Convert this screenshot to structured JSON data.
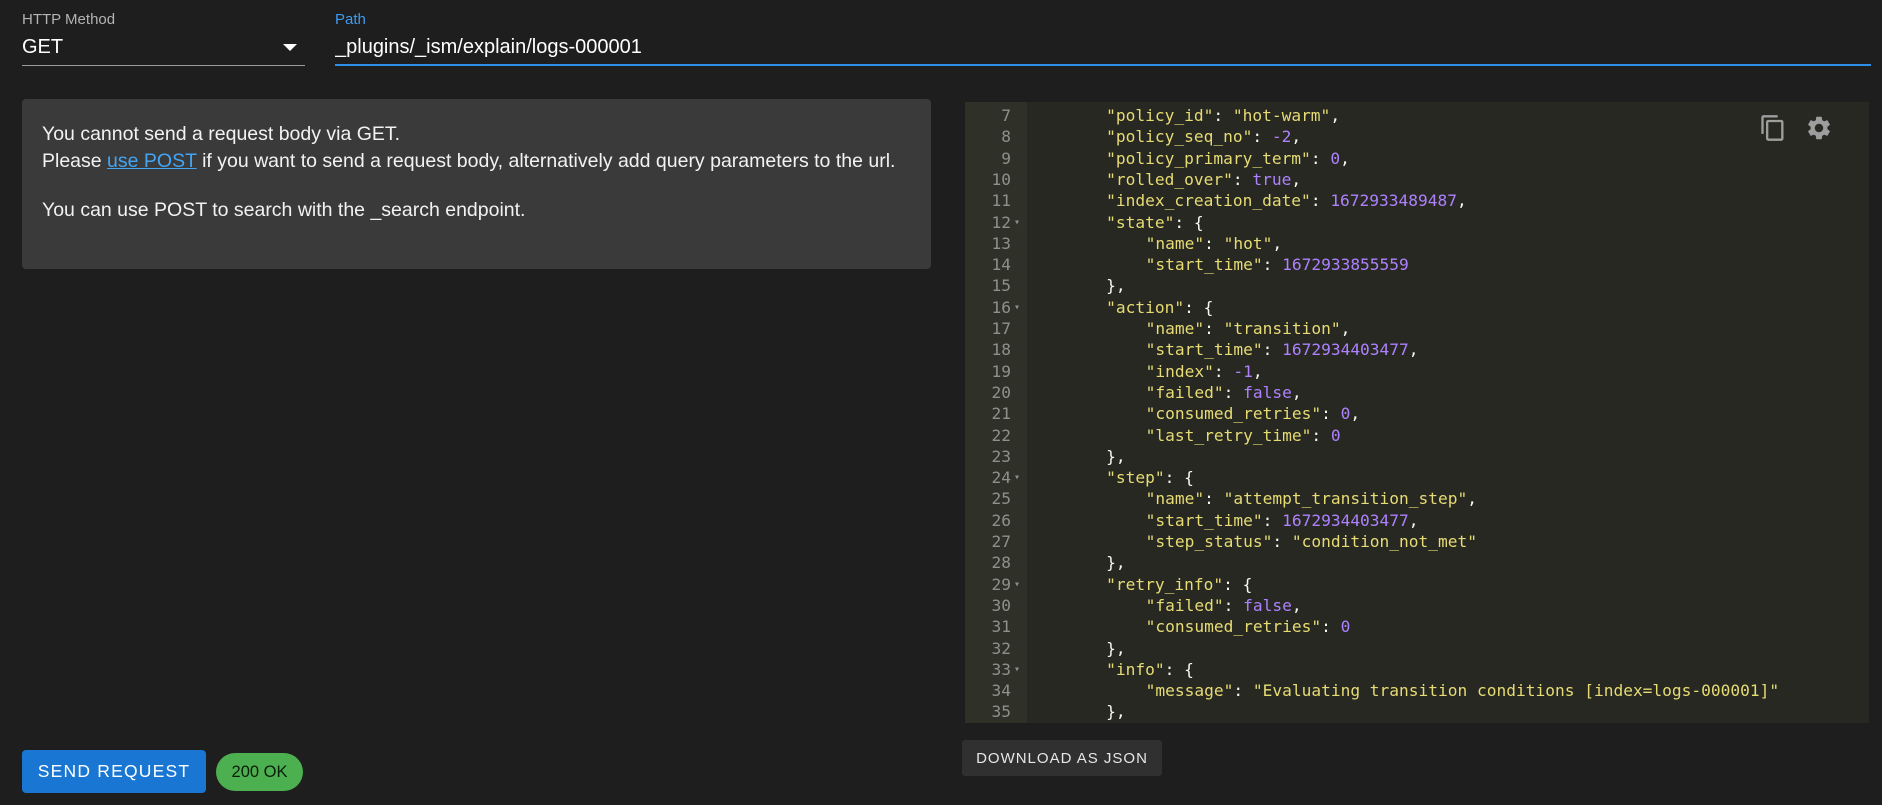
{
  "form": {
    "method_label": "HTTP Method",
    "method_value": "GET",
    "path_label": "Path",
    "path_value": "_plugins/_ism/explain/logs-000001"
  },
  "info": {
    "line1": "You cannot send a request body via GET.",
    "line2_prefix": "Please ",
    "line2_link": "use POST",
    "line2_suffix": " if you want to send a request body, alternatively add query parameters to the url.",
    "line3": "You can use POST to search with the _search endpoint."
  },
  "editor": {
    "lines": [
      {
        "n": "7",
        "fold": false,
        "indent": 2,
        "key": "\"policy_id\"",
        "value": "\"hot-warm\"",
        "vtype": "s",
        "tail": ","
      },
      {
        "n": "8",
        "fold": false,
        "indent": 2,
        "key": "\"policy_seq_no\"",
        "value": "-2",
        "vtype": "n",
        "tail": ","
      },
      {
        "n": "9",
        "fold": false,
        "indent": 2,
        "key": "\"policy_primary_term\"",
        "value": "0",
        "vtype": "n",
        "tail": ","
      },
      {
        "n": "10",
        "fold": false,
        "indent": 2,
        "key": "\"rolled_over\"",
        "value": "true",
        "vtype": "n",
        "tail": ","
      },
      {
        "n": "11",
        "fold": false,
        "indent": 2,
        "key": "\"index_creation_date\"",
        "value": "1672933489487",
        "vtype": "n",
        "tail": ","
      },
      {
        "n": "12",
        "fold": true,
        "indent": 2,
        "key": "\"state\"",
        "value": "{",
        "vtype": "p",
        "tail": ""
      },
      {
        "n": "13",
        "fold": false,
        "indent": 3,
        "key": "\"name\"",
        "value": "\"hot\"",
        "vtype": "s",
        "tail": ","
      },
      {
        "n": "14",
        "fold": false,
        "indent": 3,
        "key": "\"start_time\"",
        "value": "1672933855559",
        "vtype": "n",
        "tail": ""
      },
      {
        "n": "15",
        "fold": false,
        "indent": 2,
        "key": "",
        "value": "},",
        "vtype": "p",
        "tail": ""
      },
      {
        "n": "16",
        "fold": true,
        "indent": 2,
        "key": "\"action\"",
        "value": "{",
        "vtype": "p",
        "tail": ""
      },
      {
        "n": "17",
        "fold": false,
        "indent": 3,
        "key": "\"name\"",
        "value": "\"transition\"",
        "vtype": "s",
        "tail": ","
      },
      {
        "n": "18",
        "fold": false,
        "indent": 3,
        "key": "\"start_time\"",
        "value": "1672934403477",
        "vtype": "n",
        "tail": ","
      },
      {
        "n": "19",
        "fold": false,
        "indent": 3,
        "key": "\"index\"",
        "value": "-1",
        "vtype": "n",
        "tail": ","
      },
      {
        "n": "20",
        "fold": false,
        "indent": 3,
        "key": "\"failed\"",
        "value": "false",
        "vtype": "n",
        "tail": ","
      },
      {
        "n": "21",
        "fold": false,
        "indent": 3,
        "key": "\"consumed_retries\"",
        "value": "0",
        "vtype": "n",
        "tail": ","
      },
      {
        "n": "22",
        "fold": false,
        "indent": 3,
        "key": "\"last_retry_time\"",
        "value": "0",
        "vtype": "n",
        "tail": ""
      },
      {
        "n": "23",
        "fold": false,
        "indent": 2,
        "key": "",
        "value": "},",
        "vtype": "p",
        "tail": ""
      },
      {
        "n": "24",
        "fold": true,
        "indent": 2,
        "key": "\"step\"",
        "value": "{",
        "vtype": "p",
        "tail": ""
      },
      {
        "n": "25",
        "fold": false,
        "indent": 3,
        "key": "\"name\"",
        "value": "\"attempt_transition_step\"",
        "vtype": "s",
        "tail": ","
      },
      {
        "n": "26",
        "fold": false,
        "indent": 3,
        "key": "\"start_time\"",
        "value": "1672934403477",
        "vtype": "n",
        "tail": ","
      },
      {
        "n": "27",
        "fold": false,
        "indent": 3,
        "key": "\"step_status\"",
        "value": "\"condition_not_met\"",
        "vtype": "s",
        "tail": ""
      },
      {
        "n": "28",
        "fold": false,
        "indent": 2,
        "key": "",
        "value": "},",
        "vtype": "p",
        "tail": ""
      },
      {
        "n": "29",
        "fold": true,
        "indent": 2,
        "key": "\"retry_info\"",
        "value": "{",
        "vtype": "p",
        "tail": ""
      },
      {
        "n": "30",
        "fold": false,
        "indent": 3,
        "key": "\"failed\"",
        "value": "false",
        "vtype": "n",
        "tail": ","
      },
      {
        "n": "31",
        "fold": false,
        "indent": 3,
        "key": "\"consumed_retries\"",
        "value": "0",
        "vtype": "n",
        "tail": ""
      },
      {
        "n": "32",
        "fold": false,
        "indent": 2,
        "key": "",
        "value": "},",
        "vtype": "p",
        "tail": ""
      },
      {
        "n": "33",
        "fold": true,
        "indent": 2,
        "key": "\"info\"",
        "value": "{",
        "vtype": "p",
        "tail": ""
      },
      {
        "n": "34",
        "fold": false,
        "indent": 3,
        "key": "\"message\"",
        "value": "\"Evaluating transition conditions [index=logs-000001]\"",
        "vtype": "s",
        "tail": ""
      },
      {
        "n": "35",
        "fold": false,
        "indent": 2,
        "key": "",
        "value": "},",
        "vtype": "p",
        "tail": ""
      }
    ],
    "copy_icon": "copy-icon",
    "settings_icon": "gear-icon"
  },
  "actions": {
    "download_label": "DOWNLOAD AS JSON",
    "send_label": "SEND REQUEST",
    "status_label": "200 OK"
  },
  "colors": {
    "accent": "#1976d2",
    "status": "#4caf50",
    "editor_bg": "#272822"
  }
}
